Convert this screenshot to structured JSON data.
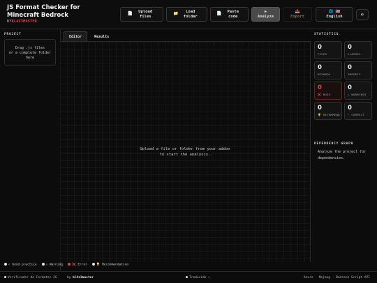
{
  "header": {
    "title": "JS Format Checker for Minecraft Bedrock",
    "byline_prefix": "BY",
    "byline_author": "BL4Z3MASTER",
    "buttons": {
      "upload_icon": "📄",
      "upload_label": "Upload files",
      "folder_icon": "📁",
      "folder_label": "Load folder",
      "paste_icon": "📄",
      "paste_label": "Paste code",
      "analyze_icon": "▶",
      "analyze_label": "Analyze",
      "export_icon": "📥",
      "export_label": "Export",
      "language_icon": "🌐",
      "language_flag": "🇺🇸",
      "language_label": "English",
      "theme_icon": "◐"
    }
  },
  "left": {
    "section_title": "PROJECT",
    "dropzone_line1": "Drag .js files",
    "dropzone_line2": "or a complete folder",
    "dropzone_line3": "here"
  },
  "center": {
    "tabs": [
      {
        "label": "Editor",
        "active": true
      },
      {
        "label": "Results",
        "active": false
      }
    ],
    "placeholder_line1": "Upload a file or folder from your addon",
    "placeholder_line2": "to start the analysis."
  },
  "stats": {
    "section_title": "STATISTICS",
    "items": [
      {
        "value": "0",
        "label": "FILES"
      },
      {
        "value": "0",
        "label": "CLASSES"
      },
      {
        "value": "0",
        "label": "METHODS"
      },
      {
        "value": "0",
        "label": "IMPORTS"
      },
      {
        "value": "0",
        "label": "❌ BUGS"
      },
      {
        "value": "0",
        "label": "⚠ WARNINGS"
      },
      {
        "value": "0",
        "label": "💡 RECOMMEND."
      },
      {
        "value": "0",
        "label": "✓ CORRECT"
      }
    ]
  },
  "dependency": {
    "section_title": "DEPENDENCY GRAPH",
    "text": "Analyze the project for dependencies."
  },
  "legend": {
    "good": "✓ Good practice",
    "warning": "⚠ Warning",
    "error": "❌ Error",
    "recommendation": "💡 Recommendation"
  },
  "footer": {
    "left_text": "Verificador de Formatos JS",
    "by_text": "by",
    "author": "bl4z3master",
    "center_text": "Traducido ✓",
    "link1": "Azure",
    "link2": "Mojang",
    "link3": "Bedrock Script API",
    "separator": "·"
  },
  "colors": {
    "accent_red": "#e04646",
    "good": "#e6e6e6",
    "warning": "#e6e6e6",
    "error": "#e04646",
    "recommendation": "#e0c060",
    "status_dot": "#e6e6e6"
  }
}
